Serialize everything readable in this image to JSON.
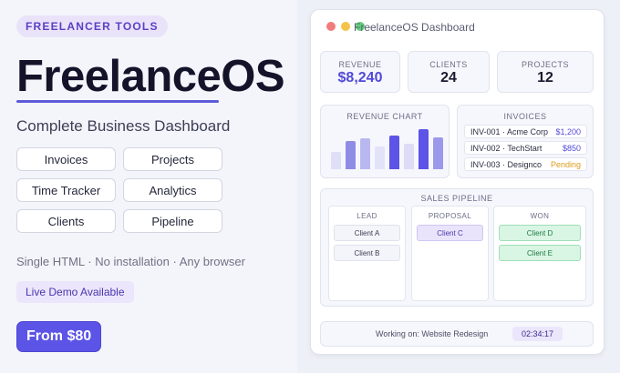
{
  "promo": {
    "tag": "FREELANCER TOOLS",
    "title": "FreelanceOS",
    "subtitle": "Complete Business Dashboard",
    "features": [
      "Invoices",
      "Projects",
      "Time Tracker",
      "Analytics",
      "Clients",
      "Pipeline"
    ],
    "tagline": "Single HTML · No installation · Any browser",
    "demo_badge": "Live Demo Available",
    "price_button": "From $80"
  },
  "window": {
    "title": "FreelanceOS Dashboard",
    "stats": [
      {
        "label": "REVENUE",
        "value": "$8,240"
      },
      {
        "label": "CLIENTS",
        "value": "24"
      },
      {
        "label": "PROJECTS",
        "value": "12"
      }
    ],
    "revenue_chart": {
      "label": "REVENUE CHART",
      "bars": [
        {
          "level": 0.38,
          "color": "#dfe0f7"
        },
        {
          "level": 0.62,
          "color": "#8f8ce6"
        },
        {
          "level": 0.68,
          "color": "#b9b7f0"
        },
        {
          "level": 0.5,
          "color": "#e2e3f8"
        },
        {
          "level": 0.74,
          "color": "#5b54e6"
        },
        {
          "level": 0.56,
          "color": "#dcdcf7"
        },
        {
          "level": 0.88,
          "color": "#5b54e6"
        },
        {
          "level": 0.7,
          "color": "#9d99ea"
        }
      ]
    },
    "invoices": {
      "label": "INVOICES",
      "rows": [
        {
          "text": "INV-001 · Acme Corp",
          "amount": "$1,200",
          "status": "paid"
        },
        {
          "text": "INV-002 · TechStart",
          "amount": "$850",
          "status": "paid"
        },
        {
          "text": "INV-003 · Designco",
          "amount": "Pending",
          "status": "pending"
        }
      ]
    },
    "pipeline": {
      "label": "SALES PIPELINE",
      "columns": [
        {
          "title": "LEAD",
          "items": [
            "Client A",
            "Client B"
          ]
        },
        {
          "title": "PROPOSAL",
          "items": [
            "Client C"
          ]
        },
        {
          "title": "WON",
          "items": [
            "Client D",
            "Client E"
          ]
        }
      ]
    },
    "status": {
      "text": "Working on: Website Redesign",
      "timer": "02:34:17"
    }
  }
}
